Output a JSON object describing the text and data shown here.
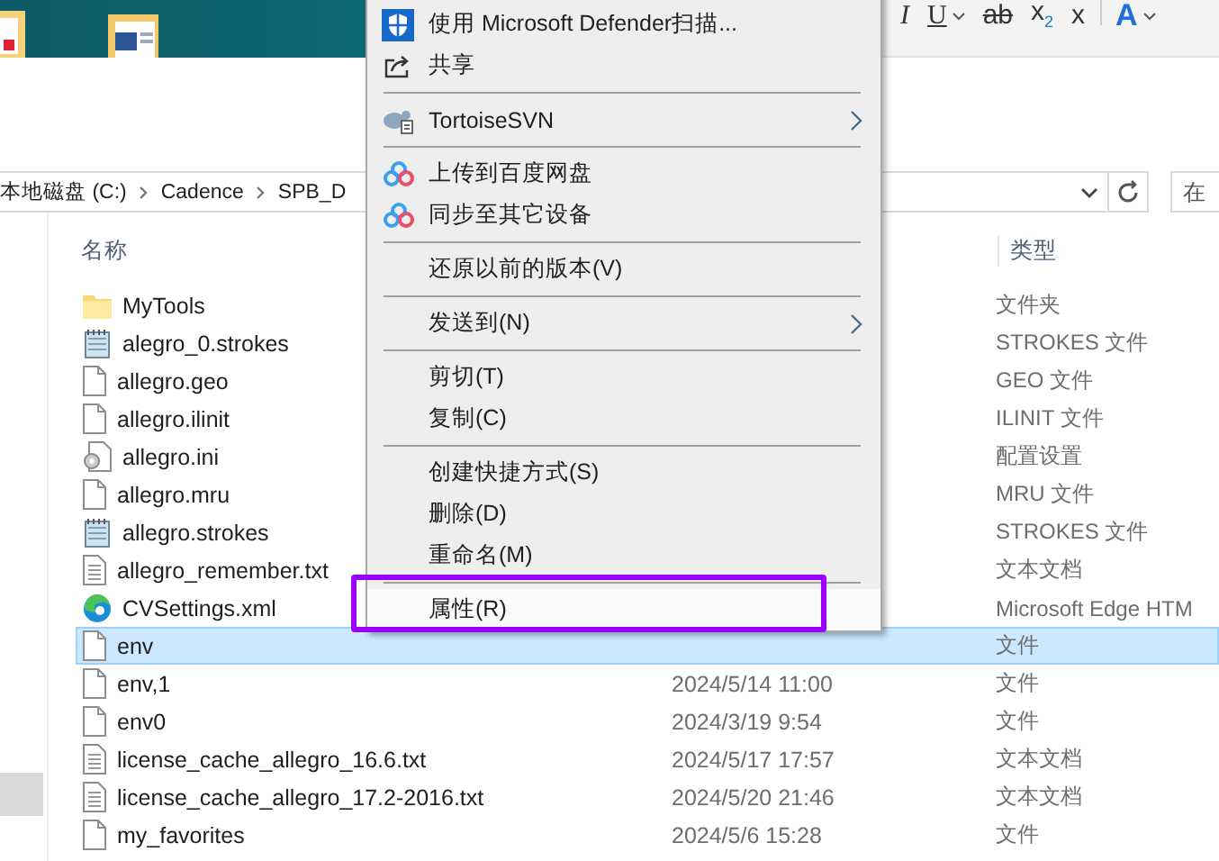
{
  "ribbon": {
    "buttons": [
      {
        "kind": "italic",
        "label": "I",
        "dropdown": false
      },
      {
        "kind": "underline",
        "label": "U",
        "dropdown": true
      },
      {
        "kind": "strike",
        "label": "ab",
        "dropdown": false
      },
      {
        "kind": "subscript",
        "label": "x$_{2}$",
        "dropdown": false
      },
      {
        "kind": "superscript",
        "label": "x",
        "dropdown": false
      },
      {
        "kind": "font-color",
        "label": "A",
        "dropdown": true
      }
    ]
  },
  "address": {
    "crumbs": [
      "本地磁盘 (C:)",
      "Cadence",
      "SPB_D"
    ]
  },
  "search": {
    "placeholder": "在"
  },
  "columns": {
    "name": "名称",
    "type": "类型"
  },
  "files": [
    {
      "kind": "folder",
      "name": "MyTools",
      "type": "文件夹",
      "selected": false
    },
    {
      "kind": "strokes",
      "name": "alegro_0.strokes",
      "type": "STROKES 文件",
      "selected": false
    },
    {
      "kind": "file",
      "name": "allegro.geo",
      "type": "GEO 文件",
      "selected": false
    },
    {
      "kind": "file",
      "name": "allegro.ilinit",
      "type": "ILINIT 文件",
      "selected": false
    },
    {
      "kind": "ini",
      "name": "allegro.ini",
      "type": "配置设置",
      "selected": false
    },
    {
      "kind": "file",
      "name": "allegro.mru",
      "type": "MRU 文件",
      "selected": false
    },
    {
      "kind": "strokes",
      "name": "allegro.strokes",
      "type": "STROKES 文件",
      "selected": false
    },
    {
      "kind": "txt",
      "name": "allegro_remember.txt",
      "type": "文本文档",
      "selected": false
    },
    {
      "kind": "edge",
      "name": "CVSettings.xml",
      "type": "Microsoft Edge HTM",
      "selected": false
    },
    {
      "kind": "file",
      "name": "env",
      "type": "文件",
      "selected": true
    },
    {
      "kind": "file",
      "name": "env,1",
      "date": "2024/5/14 11:00",
      "type": "文件",
      "selected": false
    },
    {
      "kind": "file",
      "name": "env0",
      "date": "2024/3/19 9:54",
      "type": "文件",
      "selected": false
    },
    {
      "kind": "txt",
      "name": "license_cache_allegro_16.6.txt",
      "date": "2024/5/17 17:57",
      "type": "文本文档",
      "selected": false
    },
    {
      "kind": "txt",
      "name": "license_cache_allegro_17.2-2016.txt",
      "date": "2024/5/20 21:46",
      "type": "文本文档",
      "selected": false
    },
    {
      "kind": "file",
      "name": "my_favorites",
      "date": "2024/5/6 15:28",
      "type": "文件",
      "selected": false
    }
  ],
  "menu": [
    {
      "kind": "shield",
      "label": "使用 Microsoft Defender扫描...",
      "submenu": false,
      "selected": false
    },
    {
      "kind": "share",
      "label": "共享",
      "submenu": false,
      "selected": false
    },
    {
      "kind": "separator"
    },
    {
      "kind": "svn",
      "label": "TortoiseSVN",
      "submenu": true,
      "selected": false
    },
    {
      "kind": "separator"
    },
    {
      "kind": "cloud",
      "label": "上传到百度网盘",
      "submenu": false,
      "selected": false
    },
    {
      "kind": "cloud",
      "label": "同步至其它设备",
      "submenu": false,
      "selected": false
    },
    {
      "kind": "separator"
    },
    {
      "kind": "plain",
      "label": "还原以前的版本(V)",
      "submenu": false,
      "selected": false
    },
    {
      "kind": "separator"
    },
    {
      "kind": "plain",
      "label": "发送到(N)",
      "submenu": true,
      "selected": false
    },
    {
      "kind": "separator"
    },
    {
      "kind": "plain",
      "label": "剪切(T)",
      "submenu": false,
      "selected": false
    },
    {
      "kind": "plain",
      "label": "复制(C)",
      "submenu": false,
      "selected": false
    },
    {
      "kind": "separator"
    },
    {
      "kind": "plain",
      "label": "创建快捷方式(S)",
      "submenu": false,
      "selected": false
    },
    {
      "kind": "plain",
      "label": "删除(D)",
      "submenu": false,
      "selected": false
    },
    {
      "kind": "plain",
      "label": "重命名(M)",
      "submenu": false,
      "selected": false
    },
    {
      "kind": "separator"
    },
    {
      "kind": "plain",
      "label": "属性(R)",
      "submenu": false,
      "selected": true,
      "highlighted": true
    }
  ]
}
